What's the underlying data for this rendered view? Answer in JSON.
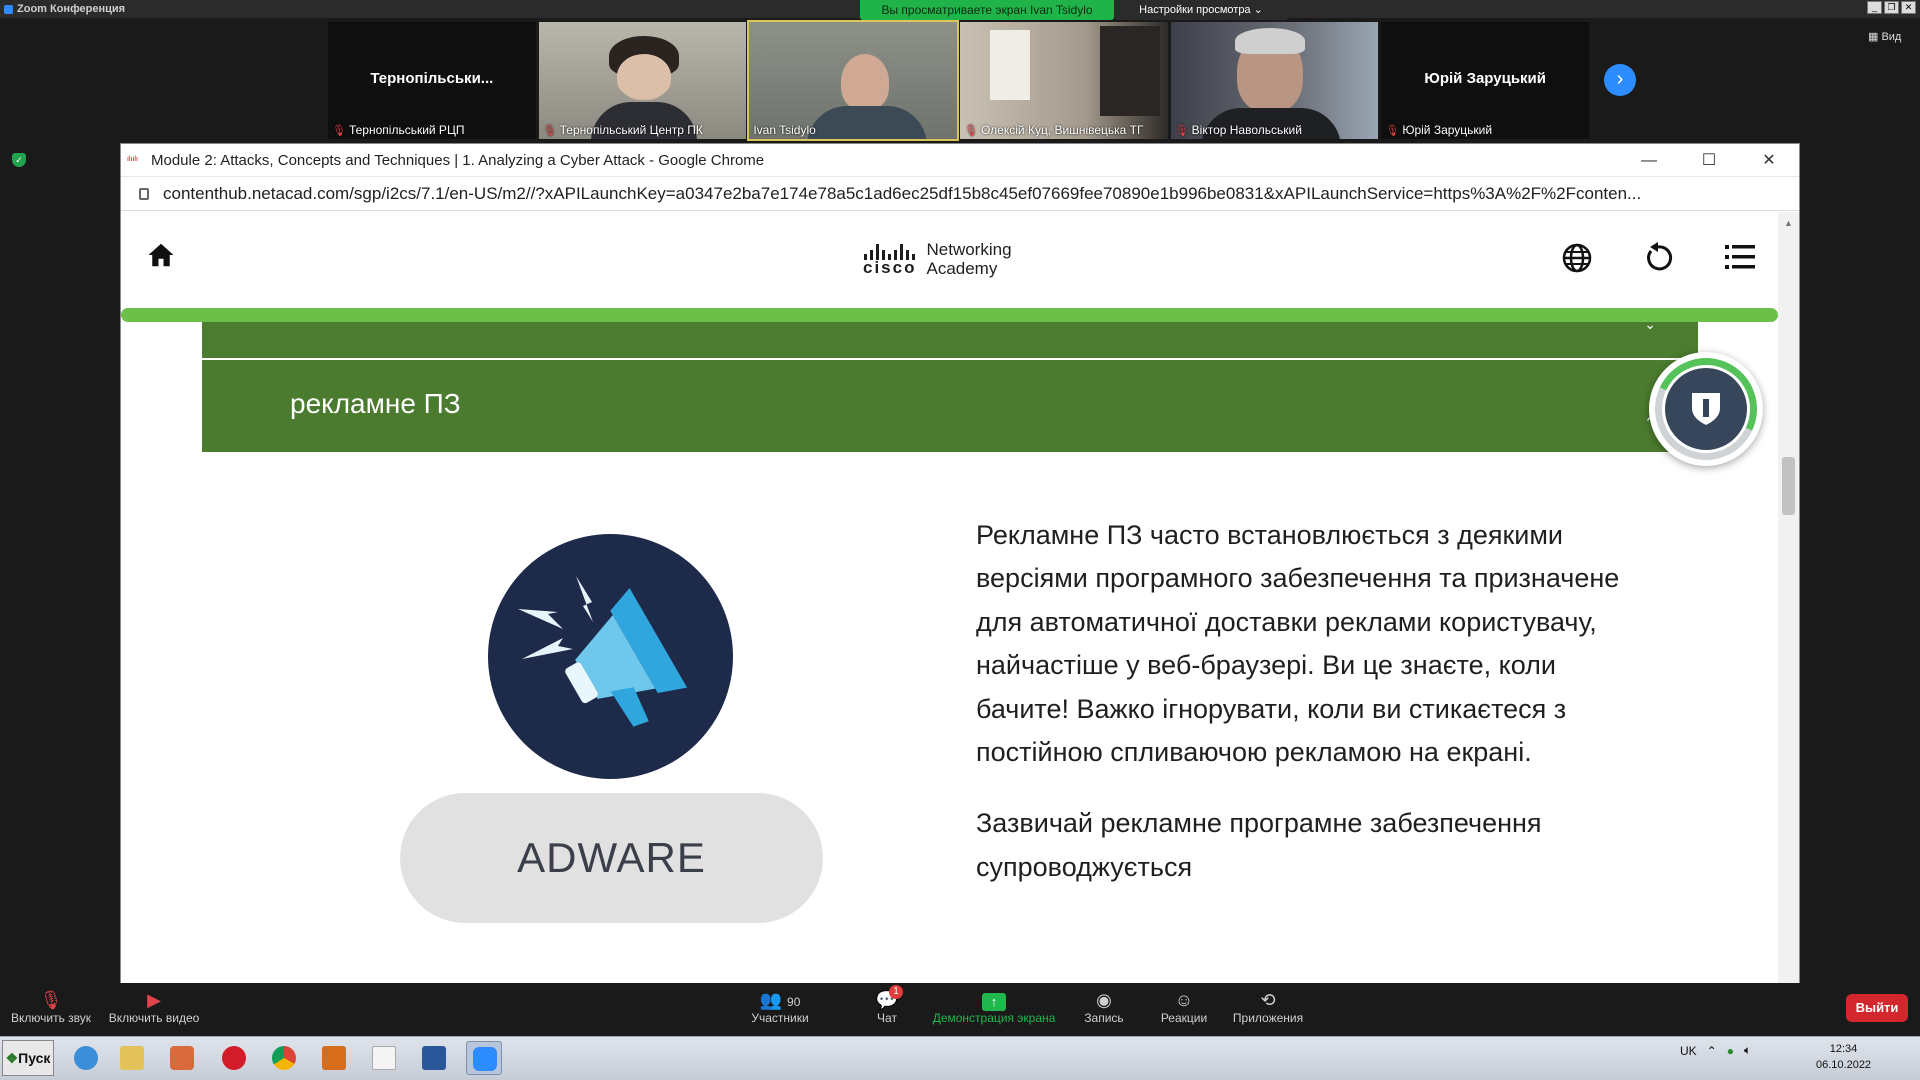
{
  "zoom": {
    "window_title": "Zoom Конференция",
    "share_banner": "Вы просматриваете экран Ivan Tsidylo",
    "view_settings": "Настройки просмотра ⌄",
    "view_button": "Вид",
    "participants_tiles": [
      {
        "name": "Тернопільський РЦП",
        "big_label": "Тернопільськи...",
        "video": false,
        "muted": true
      },
      {
        "name": "Тернопільський Центр ПК",
        "video": true,
        "muted": true
      },
      {
        "name": "Ivan Tsidylo",
        "video": true,
        "muted": false,
        "active": true
      },
      {
        "name": "Олексій Куц, Вишнівецька ТГ",
        "video": true,
        "muted": true
      },
      {
        "name": "Віктор Навольський",
        "video": true,
        "muted": true
      },
      {
        "name": "Юрій Заруцький",
        "big_label": "Юрій Заруцький",
        "video": false,
        "muted": true
      }
    ],
    "toolbar": {
      "unmute": "Включить звук",
      "start_video": "Включить видео",
      "participants": "Участники",
      "participants_count": "90",
      "chat": "Чат",
      "chat_badge": "1",
      "share_screen": "Демонстрация экрана",
      "record": "Запись",
      "reactions": "Реакции",
      "apps": "Приложения",
      "leave": "Выйти"
    }
  },
  "browser": {
    "window_title": "Module 2: Attacks, Concepts and Techniques | 1. Analyzing a Cyber Attack - Google Chrome",
    "url": "contenthub.netacad.com/sgp/i2cs/7.1/en-US/m2//?xAPILaunchKey=a0347e2ba7e174e78a5c1ad6ec25df15b8c45ef07669fee70890e1b996be0831&xAPILaunchService=https%3A%2F%2Fconten..."
  },
  "page": {
    "logo_brand": "cisco",
    "logo_line1": "Networking",
    "logo_line2": "Academy",
    "accordion_active_label": "рекламне ПЗ",
    "adware_label": "ADWARE",
    "paragraph1": "Рекламне ПЗ часто встановлюється з деякими версіями програмного забезпечення та призначене для автоматичної доставки реклами користувачу, найчастіше у веб-браузері. Ви це знаєте, коли бачите! Важко ігнорувати, коли ви стикаєтеся з постійною спливаючою рекламою на екрані.",
    "paragraph2": "Зазвичай рекламне програмне забезпечення супроводжується"
  },
  "taskbar": {
    "start": "Пуск",
    "lang": "UK",
    "time": "12:34",
    "date": "06.10.2022"
  },
  "colors": {
    "accent_green": "#4b7b2e",
    "progress_green": "#6cc04a",
    "zoom_share_green": "#1fb34a",
    "leave_red": "#d2282d",
    "adware_navy": "#1e2a4a"
  }
}
